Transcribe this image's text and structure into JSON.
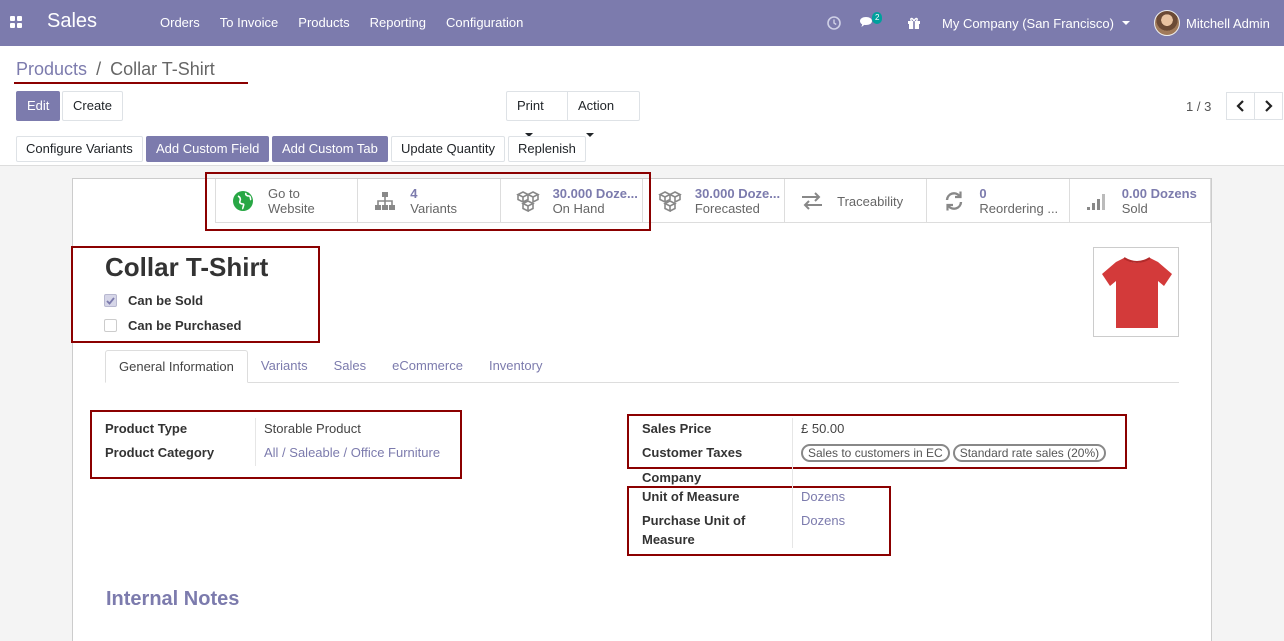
{
  "navbar": {
    "app_name": "Sales",
    "menu": [
      "Orders",
      "To Invoice",
      "Products",
      "Reporting",
      "Configuration"
    ],
    "chat_badge": "2",
    "company": "My Company (San Francisco)",
    "user": "Mitchell Admin",
    "bg_color": "#7c7bad"
  },
  "breadcrumb": {
    "parent": "Products",
    "separator": "/",
    "current": "Collar T-Shirt"
  },
  "actions": {
    "edit": "Edit",
    "create": "Create",
    "print": "Print",
    "action": "Action"
  },
  "pager": {
    "text": "1 / 3"
  },
  "toolbar": {
    "configure_variants": "Configure Variants",
    "add_custom_field": "Add Custom Field",
    "add_custom_tab": "Add Custom Tab",
    "update_quantity": "Update Quantity",
    "replenish": "Replenish"
  },
  "stats": [
    {
      "icon": "globe-icon",
      "value": "Go to",
      "label": "Website"
    },
    {
      "icon": "sitemap-icon",
      "value": "4",
      "label": "Variants"
    },
    {
      "icon": "cubes-icon",
      "value": "30.000 Doze...",
      "label": "On Hand"
    },
    {
      "icon": "cubes-icon",
      "value": "30.000 Doze...",
      "label": "Forecasted"
    },
    {
      "icon": "exchange-icon",
      "value": "",
      "label": "Traceability"
    },
    {
      "icon": "refresh-icon",
      "value": "0",
      "label": "Reordering ..."
    },
    {
      "icon": "signal-icon",
      "value": "0.00 Dozens",
      "label": "Sold"
    }
  ],
  "product": {
    "name": "Collar T-Shirt",
    "can_be_sold_label": "Can be Sold",
    "can_be_sold": true,
    "can_be_purchased_label": "Can be Purchased",
    "can_be_purchased": false
  },
  "tabs": [
    "General Information",
    "Variants",
    "Sales",
    "eCommerce",
    "Inventory"
  ],
  "general": {
    "product_type_label": "Product Type",
    "product_type": "Storable Product",
    "product_category_label": "Product Category",
    "product_category": "All / Saleable / Office Furniture",
    "sales_price_label": "Sales Price",
    "sales_price": "£ 50.00",
    "customer_taxes_label": "Customer Taxes",
    "customer_taxes": [
      "Sales to customers in EC",
      "Standard rate sales (20%)"
    ],
    "company_label": "Company",
    "uom_label": "Unit of Measure",
    "uom": "Dozens",
    "purchase_uom_label_1": "Purchase Unit of",
    "purchase_uom_label_2": "Measure",
    "purchase_uom": "Dozens"
  },
  "internal_notes": "Internal Notes",
  "colors": {
    "accent": "#7c7bad",
    "annotation": "#8b0000",
    "shirt": "#d33a3a"
  }
}
